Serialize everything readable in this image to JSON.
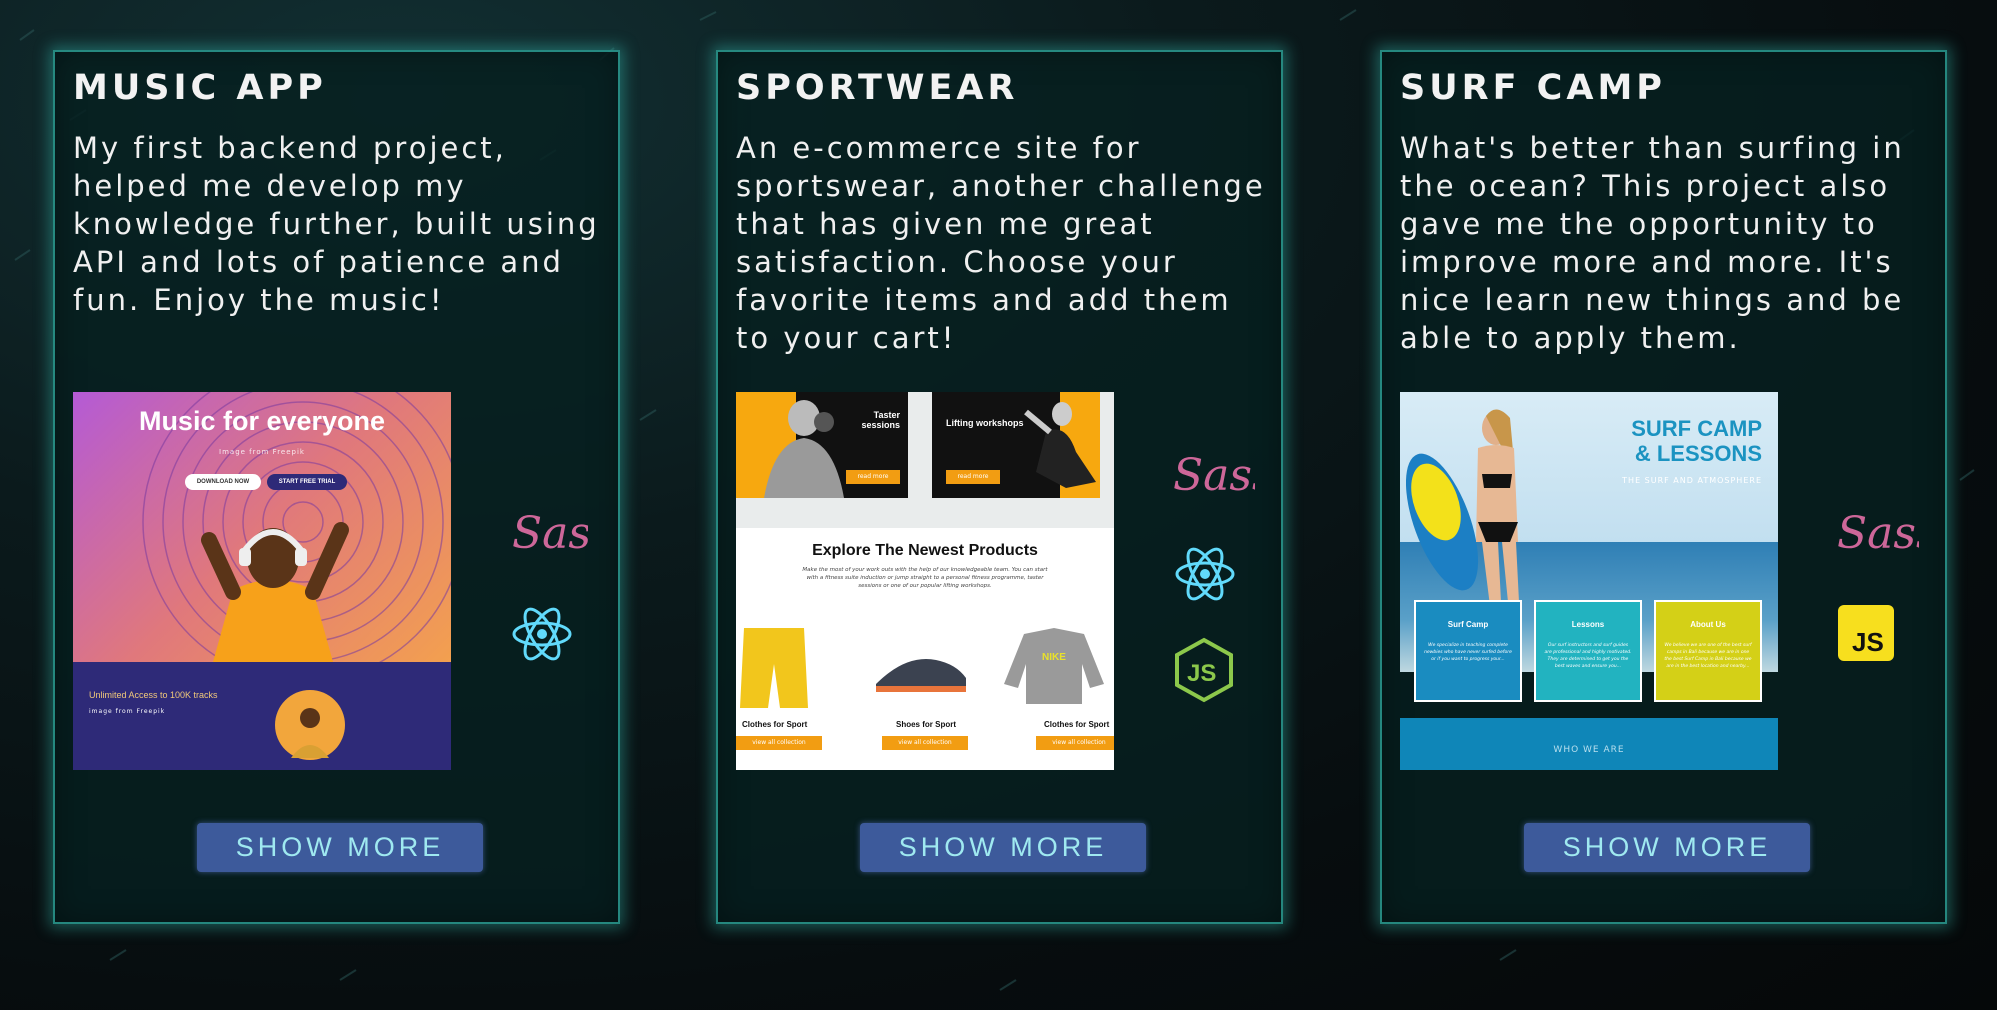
{
  "projects": [
    {
      "title": "MUSIC APP",
      "description": "My first backend project, helped me develop my knowledge further, built using API and lots of patience and fun. Enjoy the music!",
      "button": "SHOW MORE",
      "tech_icons": [
        "sass-icon",
        "react-icon"
      ],
      "screenshot": {
        "heading": "Music for everyone",
        "sub": "Image from Freepik",
        "btn1": "DOWNLOAD NOW",
        "btn2": "START FREE TRIAL",
        "bottom_text": "Unlimited Access to 100K tracks",
        "bottom_sub": "image from Freepik"
      }
    },
    {
      "title": "SPORTWEAR",
      "description": "An e-commerce site for sportswear, another challenge that has given me great satisfaction. Choose your favorite items and add them to your cart!",
      "button": "SHOW MORE",
      "tech_icons": [
        "sass-icon",
        "react-icon",
        "nodejs-icon"
      ],
      "screenshot": {
        "panel1_title": "Taster sessions",
        "panel2_title": "Lifting workshops",
        "panel_btn": "read more",
        "heading": "Explore The Newest Products",
        "text": "Make the most of your work outs with the help of our knowledgeable team. You can start with a fitness suite induction or jump straight to a personal fitness programme, taster sessions or one of our popular lifting workshops.",
        "products": [
          "Clothes for Sport",
          "Shoes for Sport",
          "Clothes for Sport"
        ],
        "product_btn": "view all collection"
      }
    },
    {
      "title": "SURF CAMP",
      "description": "What's better than surfing in the ocean? This project also gave me the opportunity to improve more and more. It's nice learn new things and be able to apply them.",
      "button": "SHOW MORE",
      "tech_icons": [
        "sass-icon",
        "javascript-icon"
      ],
      "screenshot": {
        "heading_line1": "SURF CAMP",
        "heading_line2": "& LESSONS",
        "sub": "THE SURF AND ATMOSPHERE",
        "boxes": [
          {
            "title": "Surf Camp",
            "text": "We specialize in teaching complete newbies who have never surfed before or if you want to progress your...",
            "color": "#1a8cc0"
          },
          {
            "title": "Lessons",
            "text": "Our surf instructors and surf guides are professional and highly motivated. They are determined to get you the best waves and ensure you...",
            "color": "#22b3c0"
          },
          {
            "title": "About Us",
            "text": "We believe we are one of the best surf camps in Bali because we are in one the best Surf Camp in Bali because we are in the best location and nearby...",
            "color": "#d4d017"
          }
        ],
        "footer": "WHO WE ARE"
      }
    }
  ],
  "colors": {
    "card_border": "#40e0d0",
    "button_bg": "#3d5a9b",
    "button_text": "#9fe9f0",
    "sass": "#cd6799",
    "react": "#61dafb",
    "node": "#8cc84b",
    "js": "#f7df1e"
  }
}
